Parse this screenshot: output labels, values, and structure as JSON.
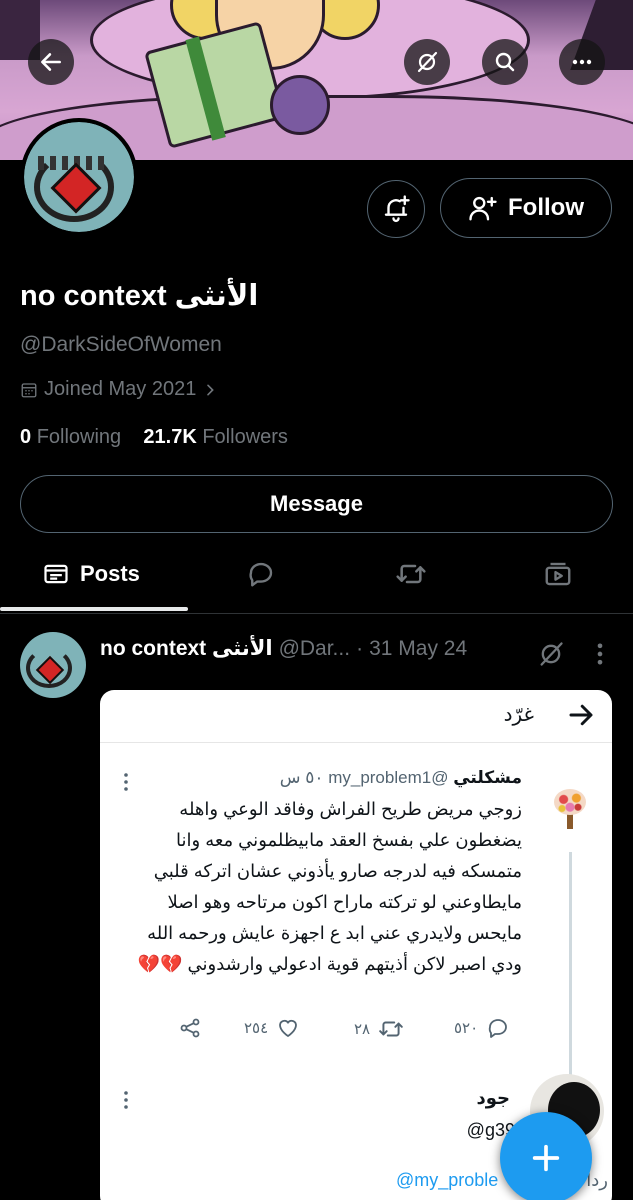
{
  "header": {
    "back_icon": "arrow-left-icon",
    "grok_icon": "grok-icon",
    "search_icon": "search-icon",
    "more_icon": "more-horizontal-icon"
  },
  "profile": {
    "display_name": "no context الأنثى",
    "handle": "@DarkSideOfWomen",
    "joined": "Joined May 2021",
    "following_count": "0",
    "following_label": "Following",
    "followers_count": "21.7K",
    "followers_label": "Followers",
    "follow_label": "Follow",
    "message_label": "Message"
  },
  "tabs": {
    "posts_label": "Posts"
  },
  "post": {
    "author_name": "no context الأنثى",
    "author_handle": "@Dar...",
    "separator": "·",
    "date": "31 May 24",
    "screenshot": {
      "title": "غرّد",
      "reply": {
        "name": "مشكلتي",
        "handle": "@my_problem1",
        "time": "٥٠ س",
        "text": "زوجي مريض طريح الفراش وفاقد الوعي واهله يضغطون علي بفسخ العقد مابيظلموني معه وانا متمسكه فيه لدرجه صارو يأذوني عشان اتركه قلبي مايطاوعني لو تركته ماراح اكون مرتاحه وهو اصلا مايحس ولايدري عني ابد ع اجهزة عايش ورحمه الله ودي اصبر لاكن أذيتهم قوية ادعولي وارشدوني 💔💔",
        "replies": "٥٢٠",
        "retweets": "٢٨",
        "likes": "٢٥٤"
      },
      "reply2": {
        "name": "جود",
        "handle": "@g39su",
        "reply_to_label": "ردا",
        "reply_to_handle": "@my_proble"
      }
    }
  },
  "colors": {
    "background": "#000000",
    "text_primary": "#e7e9ea",
    "text_secondary": "#71767b",
    "accent": "#1d9bf0",
    "border": "#536471"
  }
}
